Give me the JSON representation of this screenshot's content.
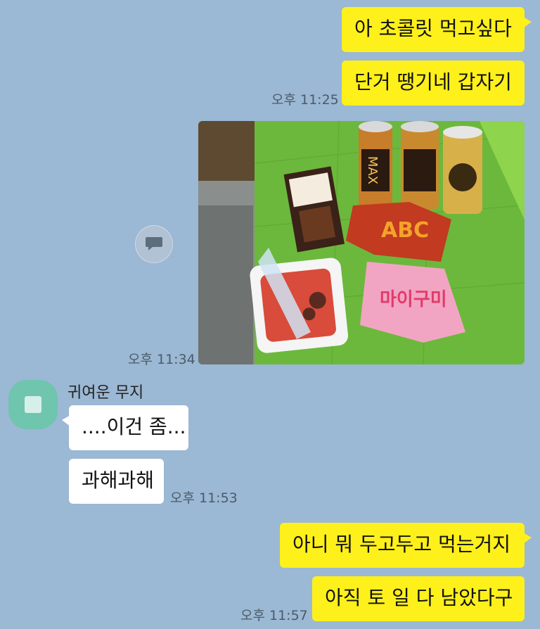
{
  "messages": [
    {
      "sender": "me",
      "text": "아 초콜릿 먹고싶다"
    },
    {
      "sender": "me",
      "text": "단거 땡기네 갑자기"
    },
    {
      "sender": "other",
      "text": "....이건 좀..."
    },
    {
      "sender": "other",
      "text": "과해과해"
    },
    {
      "sender": "me",
      "text": "아니 뭐 두고두고 먹는거지"
    },
    {
      "sender": "me",
      "text": "아직 토 일 다 남았다구"
    }
  ],
  "timestamps": {
    "t1": "오후 11:25",
    "t2": "오후 11:34",
    "t3": "오후 11:53",
    "t4": "오후 11:57"
  },
  "contact": {
    "name": "귀여운 무지"
  },
  "photo": {
    "icon": "photo-of-snacks",
    "package_text": {
      "can": "MAX",
      "pack1": "ABC",
      "pack2": "마이구미"
    }
  },
  "icons": {
    "share": "speech-bubble-icon",
    "avatar": "muji-avatar-icon"
  },
  "colors": {
    "background": "#9bb8d4",
    "my_bubble": "#fef01b",
    "other_bubble": "#ffffff",
    "avatar": "#6fc5ad"
  }
}
